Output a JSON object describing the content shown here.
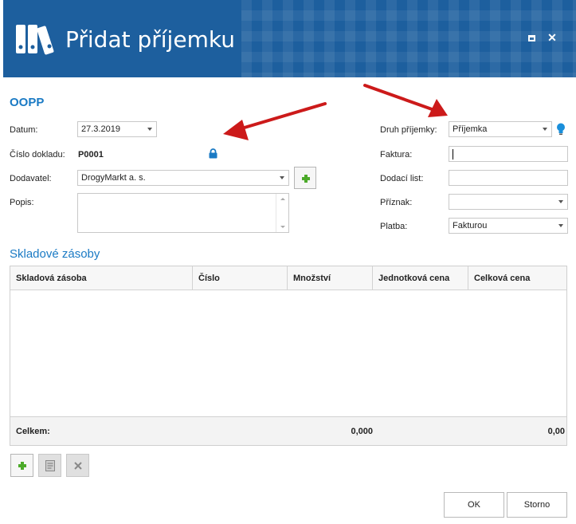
{
  "window": {
    "title": "Přidat příjemku"
  },
  "section": {
    "title": "OOPP"
  },
  "form": {
    "datum_label": "Datum:",
    "datum_value": "27.3.2019",
    "cislo_label": "Číslo dokladu:",
    "cislo_value": "P0001",
    "dodavatel_label": "Dodavatel:",
    "dodavatel_value": "DrogyMarkt a. s.",
    "popis_label": "Popis:",
    "popis_value": "",
    "druh_label": "Druh příjemky:",
    "druh_value": "Příjemka",
    "faktura_label": "Faktura:",
    "faktura_value": "",
    "dodaci_label": "Dodací list:",
    "dodaci_value": "",
    "priznak_label": "Příznak:",
    "priznak_value": "",
    "platba_label": "Platba:",
    "platba_value": "Fakturou"
  },
  "stock": {
    "title": "Skladové zásoby",
    "columns": [
      "Skladová zásoba",
      "Číslo",
      "Množství",
      "Jednotková cena",
      "Celková cena"
    ],
    "rows": [],
    "footer": {
      "label": "Celkem:",
      "mnozstvi": "0,000",
      "celkova": "0,00"
    }
  },
  "buttons": {
    "ok": "OK",
    "storno": "Storno"
  },
  "colors": {
    "header": "#1d5f9e",
    "accent": "#1a7ac4",
    "add": "#4caa2a",
    "annotation": "#cc1a1a"
  }
}
